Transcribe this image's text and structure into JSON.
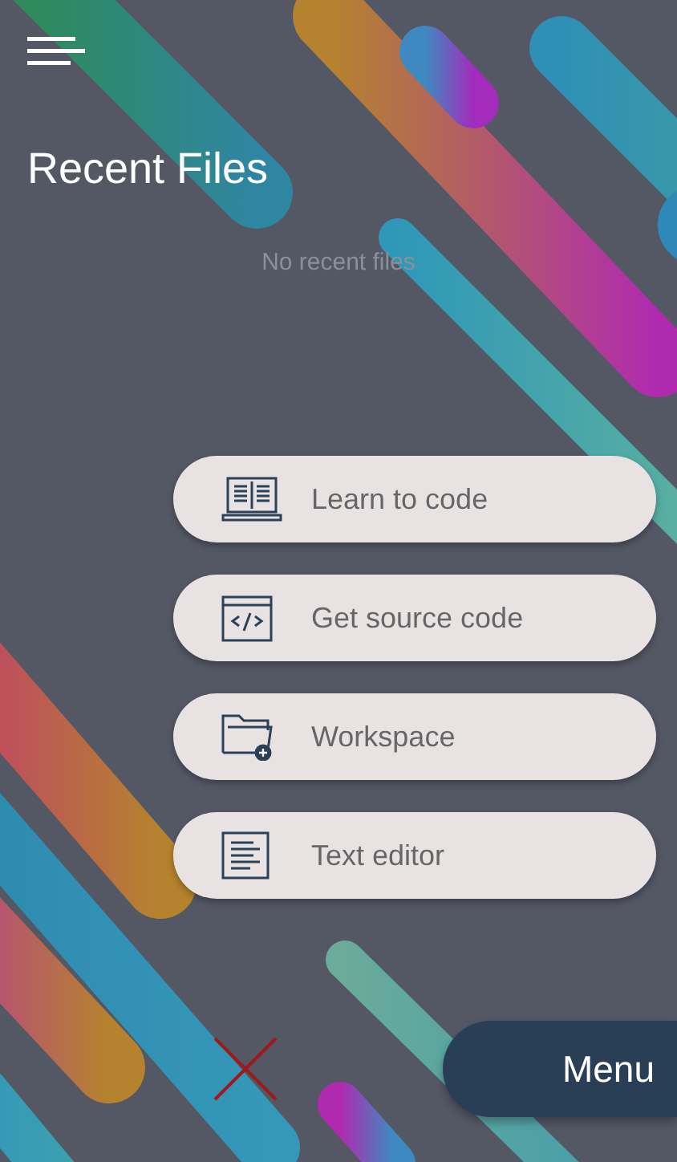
{
  "header": {
    "title": "Recent Files"
  },
  "recent_files": {
    "empty_message": "No recent files"
  },
  "actions": [
    {
      "kind": "learn",
      "label": "Learn to code"
    },
    {
      "kind": "source",
      "label": "Get source code"
    },
    {
      "kind": "workspace",
      "label": "Workspace"
    },
    {
      "kind": "editor",
      "label": "Text editor"
    }
  ],
  "menu_button": {
    "label": "Menu"
  }
}
